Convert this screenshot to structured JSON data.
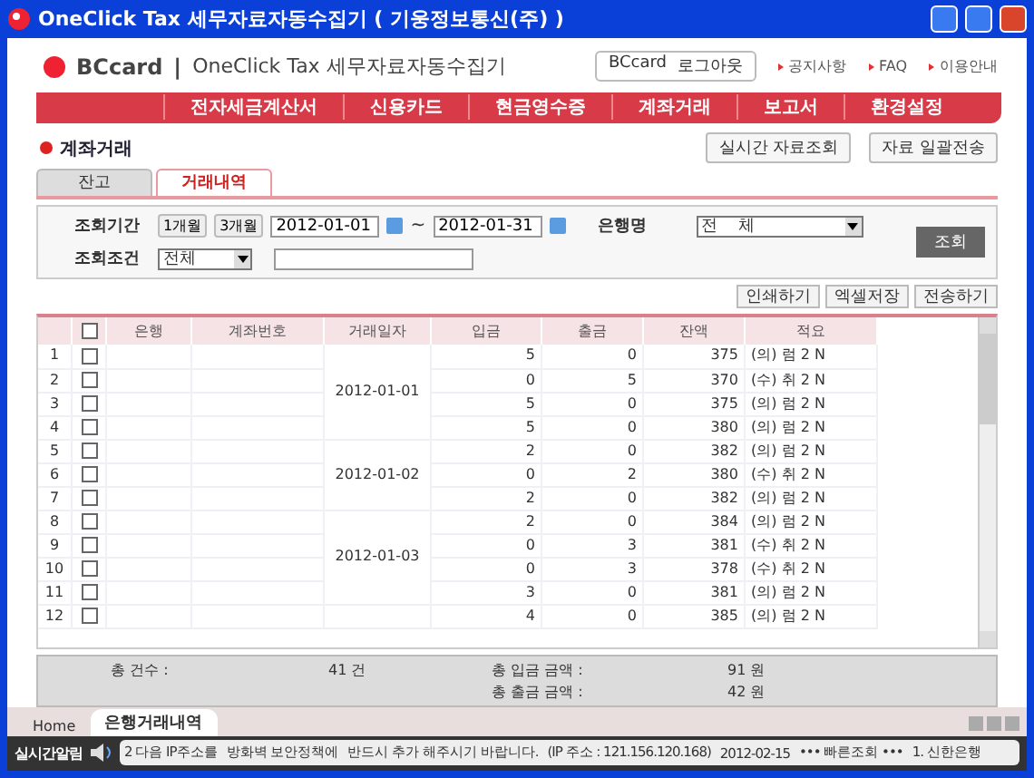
{
  "window": {
    "title": "OneClick Tax 세무자료자동수집기 ( 기웅정보통신(주) )"
  },
  "header": {
    "brand": "BCcard",
    "separator": "|",
    "product": "OneClick Tax 세무자료자동수집기",
    "user": "BCcard",
    "logout": "로그아웃",
    "links": [
      "공지사항",
      "FAQ",
      "이용안내"
    ]
  },
  "nav": [
    "전자세금계산서",
    "신용카드",
    "현금영수증",
    "계좌거래",
    "보고서",
    "환경설정"
  ],
  "page": {
    "title": "계좌거래",
    "actions": [
      "실시간 자료조회",
      "자료 일괄전송"
    ]
  },
  "tabs": [
    {
      "label": "잔고",
      "selected": false
    },
    {
      "label": "거래내역",
      "selected": true
    }
  ],
  "search": {
    "period_label": "조회기간",
    "quick": [
      "1개월",
      "3개월"
    ],
    "from": "2012-01-01",
    "sep": "~",
    "to": "2012-01-31",
    "bank_label": "은행명",
    "bank": "전    체",
    "condition_label": "조회조건",
    "condition": "전체",
    "button": "조회"
  },
  "toolbar": [
    "인쇄하기",
    "엑셀저장",
    "전송하기"
  ],
  "table": {
    "columns": [
      "은행",
      "계좌번호",
      "거래일자",
      "입금",
      "출금",
      "잔액",
      "적요"
    ],
    "all_checked": false,
    "groups": [
      {
        "date": "2012-01-01",
        "rows": [
          {
            "no": "1",
            "checked": false,
            "deposit": "5",
            "withdrawal": "0",
            "balance": "375",
            "memo": "(의) 럼 2 N"
          },
          {
            "no": "2",
            "checked": false,
            "deposit": "0",
            "withdrawal": "5",
            "balance": "370",
            "memo": "(수) 취 2 N"
          },
          {
            "no": "3",
            "checked": false,
            "deposit": "5",
            "withdrawal": "0",
            "balance": "375",
            "memo": "(의) 럼 2 N"
          },
          {
            "no": "4",
            "checked": false,
            "deposit": "5",
            "withdrawal": "0",
            "balance": "380",
            "memo": "(의) 럼 2 N"
          }
        ]
      },
      {
        "date": "2012-01-02",
        "rows": [
          {
            "no": "5",
            "checked": false,
            "deposit": "2",
            "withdrawal": "0",
            "balance": "382",
            "memo": "(의) 럼 2 N"
          },
          {
            "no": "6",
            "checked": false,
            "deposit": "0",
            "withdrawal": "2",
            "balance": "380",
            "memo": "(수) 취 2 N"
          },
          {
            "no": "7",
            "checked": false,
            "deposit": "2",
            "withdrawal": "0",
            "balance": "382",
            "memo": "(의) 럼 2 N"
          }
        ]
      },
      {
        "date": "2012-01-03",
        "rows": [
          {
            "no": "8",
            "checked": false,
            "deposit": "2",
            "withdrawal": "0",
            "balance": "384",
            "memo": "(의) 럼 2 N"
          },
          {
            "no": "9",
            "checked": false,
            "deposit": "0",
            "withdrawal": "3",
            "balance": "381",
            "memo": "(수) 취 2 N"
          },
          {
            "no": "10",
            "checked": false,
            "deposit": "0",
            "withdrawal": "3",
            "balance": "378",
            "memo": "(수) 취 2 N"
          },
          {
            "no": "11",
            "checked": false,
            "deposit": "3",
            "withdrawal": "0",
            "balance": "381",
            "memo": "(의) 럼 2 N"
          }
        ]
      },
      {
        "rows": [
          {
            "no": "12",
            "checked": false,
            "deposit": "4",
            "withdrawal": "0",
            "balance": "385",
            "memo": "(의) 럼 2 N"
          }
        ]
      }
    ]
  },
  "summary": {
    "count_label": "총 건수 :",
    "count": "41 건",
    "deposit_label": "총 입금 금액 :",
    "deposit": "91 원",
    "withdraw_label": "총 출금 금액 :",
    "withdraw": "42 원"
  },
  "bottom_tabs": [
    {
      "label": "Home",
      "selected": false
    },
    {
      "label": "은행거래내역",
      "selected": true
    }
  ],
  "status": {
    "label": "실시간알림",
    "ticker": [
      "2 다음 IP주소를",
      "방화벽 보안정책에",
      "반드시 추가 해주시기 바랍니다.",
      "(IP 주소 : 121.156.120.168)",
      "2012-02-15",
      "••• 빠른조회 •••",
      "1. 신한은행"
    ]
  }
}
